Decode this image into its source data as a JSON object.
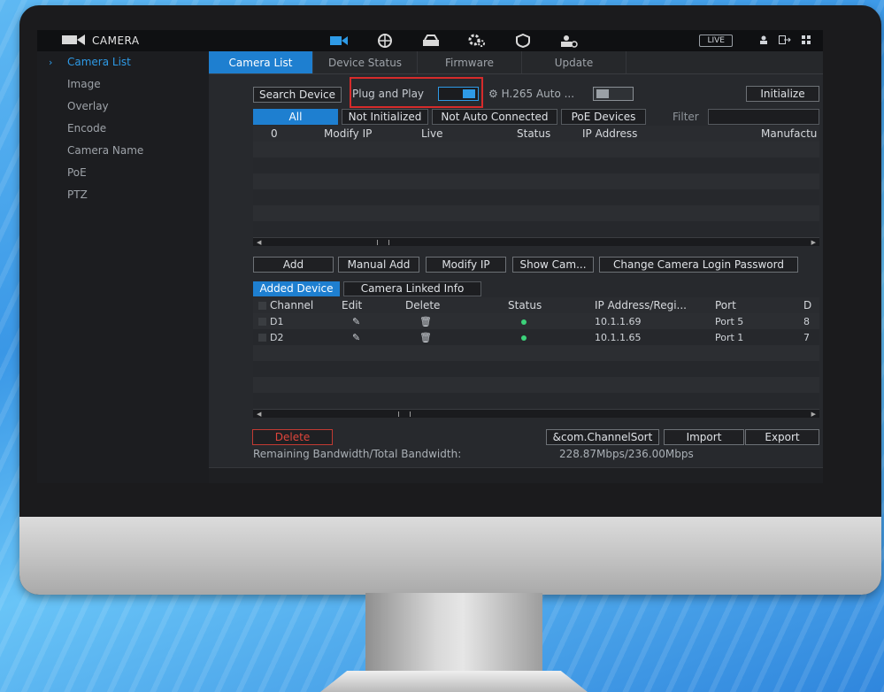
{
  "topbar": {
    "title": "CAMERA",
    "live_label": "LIVE",
    "icons": [
      "camera-icon",
      "network-icon",
      "storage-icon",
      "settings-icon",
      "shield-icon",
      "account-icon"
    ],
    "right_icons": [
      "user-icon",
      "logout-icon",
      "grid-icon"
    ]
  },
  "sidebar": {
    "items": [
      {
        "label": "Camera List",
        "active": true
      },
      {
        "label": "Image"
      },
      {
        "label": "Overlay"
      },
      {
        "label": "Encode"
      },
      {
        "label": "Camera Name"
      },
      {
        "label": "PoE"
      },
      {
        "label": "PTZ"
      }
    ]
  },
  "tabs": [
    {
      "label": "Camera List",
      "active": true
    },
    {
      "label": "Device Status"
    },
    {
      "label": "Firmware"
    },
    {
      "label": "Update"
    }
  ],
  "toolbar": {
    "search_device": "Search Device",
    "plug_and_play": "Plug and Play",
    "h265_label": "H.265 Auto ...",
    "initialize": "Initialize",
    "filter_label": "Filter",
    "filter_value": ""
  },
  "filters": [
    "All",
    "Not Initialized",
    "Not Auto Connected",
    "PoE Devices"
  ],
  "search_table": {
    "headers": [
      "0",
      "Modify IP",
      "Live",
      "Status",
      "IP Address",
      "Manufactu"
    ]
  },
  "actions": {
    "add": "Add",
    "manual_add": "Manual Add",
    "modify_ip": "Modify IP",
    "show_cam": "Show Cam...",
    "change_password": "Change Camera Login Password"
  },
  "subtabs": [
    "Added Device",
    "Camera Linked Info"
  ],
  "added_table": {
    "headers": [
      "Channel",
      "Edit",
      "Delete",
      "Status",
      "IP Address/Regi...",
      "Port",
      "D"
    ],
    "rows": [
      {
        "channel": "D1",
        "ip": "10.1.1.69",
        "port": "Port 5",
        "extra": "8"
      },
      {
        "channel": "D2",
        "ip": "10.1.1.65",
        "port": "Port 1",
        "extra": "7"
      }
    ]
  },
  "footer": {
    "delete": "Delete",
    "channel_sort": "&com.ChannelSort",
    "import": "Import",
    "export": "Export",
    "bandwidth_label": "Remaining Bandwidth/Total Bandwidth:",
    "bandwidth_value": "228.87Mbps/236.00Mbps"
  },
  "colors": {
    "accent": "#1e7fd0",
    "active_text": "#2e9ae6",
    "highlight_box": "#d62b2b",
    "status_online": "#3cd27a",
    "delete_text": "#e0453b"
  }
}
